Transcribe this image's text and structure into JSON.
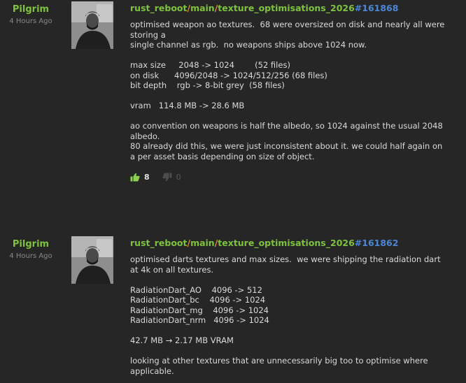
{
  "posts": [
    {
      "author": "Pilgrim",
      "time": "4 Hours Ago",
      "repo": "rust_reboot",
      "branch": "main",
      "path": "texture_optimisations_2026",
      "changeset": "#161868",
      "lines": [
        "optimised weapon ao textures.  68 were oversized on disk and nearly all were",
        "storing a",
        "single channel as rgb.  no weapons ships above 1024 now.",
        "",
        "max size     2048 -> 1024        (52 files)",
        "on disk      4096/2048 -> 1024/512/256 (68 files)",
        "bit depth    rgb -> 8-bit grey  (58 files)",
        "",
        "vram   114.8 MB -> 28.6 MB",
        "",
        "ao convention on weapons is half the albedo, so 1024 against the usual 2048",
        "albedo.",
        "80 already did this, we were just inconsistent about it. we could half again on",
        "a per asset basis depending on size of object."
      ],
      "upvotes": "8",
      "downvotes": "0"
    },
    {
      "author": "Pilgrim",
      "time": "4 Hours Ago",
      "repo": "rust_reboot",
      "branch": "main",
      "path": "texture_optimisations_2026",
      "changeset": "#161862",
      "lines": [
        "optimised darts textures and max sizes.  we were shipping the radiation dart",
        "at 4k on all textures.",
        "",
        "RadiationDart_AO    4096 -> 512",
        "RadiationDart_bc    4096 -> 1024",
        "RadiationDart_mg    4096 -> 1024",
        "RadiationDart_nrm   4096 -> 1024",
        "",
        "42.7 MB → 2.17 MB VRAM",
        "",
        "looking at other textures that are unnecessarily big too to optimise where",
        "applicable."
      ]
    }
  ],
  "colors": {
    "background": "#262626",
    "author": "#7fc23c",
    "repo": "#7fc23c",
    "separator": "#e58a2a",
    "changeset": "#4d86d8",
    "upvote_icon": "#8fd14f"
  },
  "icons": {
    "upvote": "thumbs-up-icon",
    "downvote": "thumbs-down-icon"
  }
}
